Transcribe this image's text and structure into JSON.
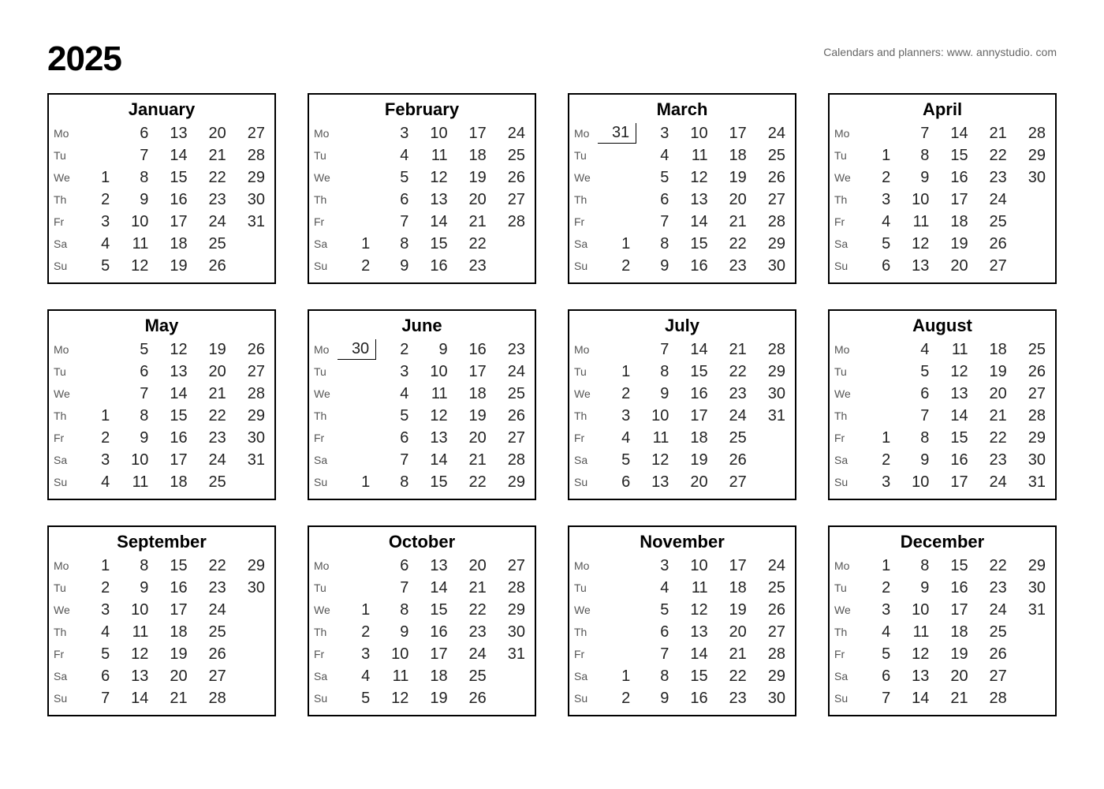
{
  "year": "2025",
  "attribution": "Calendars and planners:  www. annystudio. com",
  "day_labels": [
    "Mo",
    "Tu",
    "We",
    "Th",
    "Fr",
    "Sa",
    "Su"
  ],
  "months": [
    {
      "name": "January",
      "rows": [
        [
          "",
          "6",
          "13",
          "20",
          "27"
        ],
        [
          "",
          "7",
          "14",
          "21",
          "28"
        ],
        [
          "1",
          "8",
          "15",
          "22",
          "29"
        ],
        [
          "2",
          "9",
          "16",
          "23",
          "30"
        ],
        [
          "3",
          "10",
          "17",
          "24",
          "31"
        ],
        [
          "4",
          "11",
          "18",
          "25",
          ""
        ],
        [
          "5",
          "12",
          "19",
          "26",
          ""
        ]
      ],
      "prev": []
    },
    {
      "name": "February",
      "rows": [
        [
          "",
          "3",
          "10",
          "17",
          "24"
        ],
        [
          "",
          "4",
          "11",
          "18",
          "25"
        ],
        [
          "",
          "5",
          "12",
          "19",
          "26"
        ],
        [
          "",
          "6",
          "13",
          "20",
          "27"
        ],
        [
          "",
          "7",
          "14",
          "21",
          "28"
        ],
        [
          "1",
          "8",
          "15",
          "22",
          ""
        ],
        [
          "2",
          "9",
          "16",
          "23",
          ""
        ]
      ],
      "prev": []
    },
    {
      "name": "March",
      "rows": [
        [
          "31",
          "3",
          "10",
          "17",
          "24"
        ],
        [
          "",
          "4",
          "11",
          "18",
          "25"
        ],
        [
          "",
          "5",
          "12",
          "19",
          "26"
        ],
        [
          "",
          "6",
          "13",
          "20",
          "27"
        ],
        [
          "",
          "7",
          "14",
          "21",
          "28"
        ],
        [
          "1",
          "8",
          "15",
          "22",
          "29"
        ],
        [
          "2",
          "9",
          "16",
          "23",
          "30"
        ]
      ],
      "prev": [
        [
          0,
          0
        ]
      ]
    },
    {
      "name": "April",
      "rows": [
        [
          "",
          "7",
          "14",
          "21",
          "28"
        ],
        [
          "1",
          "8",
          "15",
          "22",
          "29"
        ],
        [
          "2",
          "9",
          "16",
          "23",
          "30"
        ],
        [
          "3",
          "10",
          "17",
          "24",
          ""
        ],
        [
          "4",
          "11",
          "18",
          "25",
          ""
        ],
        [
          "5",
          "12",
          "19",
          "26",
          ""
        ],
        [
          "6",
          "13",
          "20",
          "27",
          ""
        ]
      ],
      "prev": []
    },
    {
      "name": "May",
      "rows": [
        [
          "",
          "5",
          "12",
          "19",
          "26"
        ],
        [
          "",
          "6",
          "13",
          "20",
          "27"
        ],
        [
          "",
          "7",
          "14",
          "21",
          "28"
        ],
        [
          "1",
          "8",
          "15",
          "22",
          "29"
        ],
        [
          "2",
          "9",
          "16",
          "23",
          "30"
        ],
        [
          "3",
          "10",
          "17",
          "24",
          "31"
        ],
        [
          "4",
          "11",
          "18",
          "25",
          ""
        ]
      ],
      "prev": []
    },
    {
      "name": "June",
      "rows": [
        [
          "30",
          "2",
          "9",
          "16",
          "23"
        ],
        [
          "",
          "3",
          "10",
          "17",
          "24"
        ],
        [
          "",
          "4",
          "11",
          "18",
          "25"
        ],
        [
          "",
          "5",
          "12",
          "19",
          "26"
        ],
        [
          "",
          "6",
          "13",
          "20",
          "27"
        ],
        [
          "",
          "7",
          "14",
          "21",
          "28"
        ],
        [
          "1",
          "8",
          "15",
          "22",
          "29"
        ]
      ],
      "prev": [
        [
          0,
          0
        ]
      ]
    },
    {
      "name": "July",
      "rows": [
        [
          "",
          "7",
          "14",
          "21",
          "28"
        ],
        [
          "1",
          "8",
          "15",
          "22",
          "29"
        ],
        [
          "2",
          "9",
          "16",
          "23",
          "30"
        ],
        [
          "3",
          "10",
          "17",
          "24",
          "31"
        ],
        [
          "4",
          "11",
          "18",
          "25",
          ""
        ],
        [
          "5",
          "12",
          "19",
          "26",
          ""
        ],
        [
          "6",
          "13",
          "20",
          "27",
          ""
        ]
      ],
      "prev": []
    },
    {
      "name": "August",
      "rows": [
        [
          "",
          "4",
          "11",
          "18",
          "25"
        ],
        [
          "",
          "5",
          "12",
          "19",
          "26"
        ],
        [
          "",
          "6",
          "13",
          "20",
          "27"
        ],
        [
          "",
          "7",
          "14",
          "21",
          "28"
        ],
        [
          "1",
          "8",
          "15",
          "22",
          "29"
        ],
        [
          "2",
          "9",
          "16",
          "23",
          "30"
        ],
        [
          "3",
          "10",
          "17",
          "24",
          "31"
        ]
      ],
      "prev": []
    },
    {
      "name": "September",
      "rows": [
        [
          "1",
          "8",
          "15",
          "22",
          "29"
        ],
        [
          "2",
          "9",
          "16",
          "23",
          "30"
        ],
        [
          "3",
          "10",
          "17",
          "24",
          ""
        ],
        [
          "4",
          "11",
          "18",
          "25",
          ""
        ],
        [
          "5",
          "12",
          "19",
          "26",
          ""
        ],
        [
          "6",
          "13",
          "20",
          "27",
          ""
        ],
        [
          "7",
          "14",
          "21",
          "28",
          ""
        ]
      ],
      "prev": []
    },
    {
      "name": "October",
      "rows": [
        [
          "",
          "6",
          "13",
          "20",
          "27"
        ],
        [
          "",
          "7",
          "14",
          "21",
          "28"
        ],
        [
          "1",
          "8",
          "15",
          "22",
          "29"
        ],
        [
          "2",
          "9",
          "16",
          "23",
          "30"
        ],
        [
          "3",
          "10",
          "17",
          "24",
          "31"
        ],
        [
          "4",
          "11",
          "18",
          "25",
          ""
        ],
        [
          "5",
          "12",
          "19",
          "26",
          ""
        ]
      ],
      "prev": []
    },
    {
      "name": "November",
      "rows": [
        [
          "",
          "3",
          "10",
          "17",
          "24"
        ],
        [
          "",
          "4",
          "11",
          "18",
          "25"
        ],
        [
          "",
          "5",
          "12",
          "19",
          "26"
        ],
        [
          "",
          "6",
          "13",
          "20",
          "27"
        ],
        [
          "",
          "7",
          "14",
          "21",
          "28"
        ],
        [
          "1",
          "8",
          "15",
          "22",
          "29"
        ],
        [
          "2",
          "9",
          "16",
          "23",
          "30"
        ]
      ],
      "prev": []
    },
    {
      "name": "December",
      "rows": [
        [
          "1",
          "8",
          "15",
          "22",
          "29"
        ],
        [
          "2",
          "9",
          "16",
          "23",
          "30"
        ],
        [
          "3",
          "10",
          "17",
          "24",
          "31"
        ],
        [
          "4",
          "11",
          "18",
          "25",
          ""
        ],
        [
          "5",
          "12",
          "19",
          "26",
          ""
        ],
        [
          "6",
          "13",
          "20",
          "27",
          ""
        ],
        [
          "7",
          "14",
          "21",
          "28",
          ""
        ]
      ],
      "prev": []
    }
  ]
}
